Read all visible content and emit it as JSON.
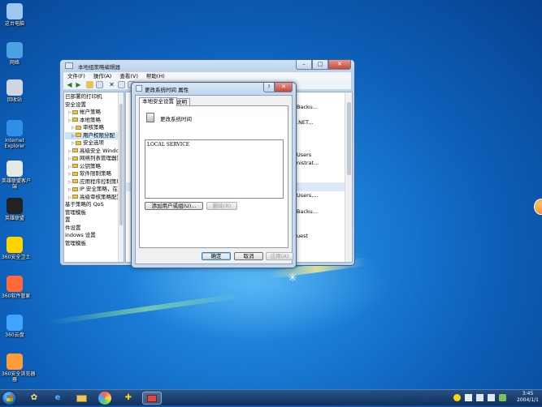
{
  "desktop": {
    "icons": [
      {
        "label": "这台电脑",
        "icon": "computer-icon"
      },
      {
        "label": "网络",
        "icon": "network-icon"
      },
      {
        "label": "回收站",
        "icon": "recycle-bin-icon"
      },
      {
        "label": "Internet",
        "label2": "Explorer",
        "icon": "ie-icon"
      },
      {
        "label": "英雄联盟客户",
        "label2": "端",
        "icon": "lol-client-icon"
      },
      {
        "label": "英雄联盟",
        "icon": "lol-icon"
      },
      {
        "label": "360安全卫士",
        "icon": "360-safe-icon"
      },
      {
        "label": "360软件管家",
        "icon": "360-soft-icon"
      },
      {
        "label": "360云盘",
        "icon": "360-cloud-icon"
      },
      {
        "label": "360安全浏览器",
        "label2": "器",
        "icon": "360-browser-icon"
      }
    ]
  },
  "main_window": {
    "title": "本地组策略编辑器",
    "menu": [
      "文件(F)",
      "操作(A)",
      "查看(V)",
      "帮助(H)"
    ],
    "tree": [
      {
        "text": "已部署的打印机",
        "indent": 0,
        "folder": false
      },
      {
        "text": "安全设置",
        "indent": 0,
        "folder": false
      },
      {
        "text": "帐户策略",
        "indent": 1,
        "folder": true
      },
      {
        "text": "本地策略",
        "indent": 1,
        "folder": true
      },
      {
        "text": "审核策略",
        "indent": 2,
        "folder": true
      },
      {
        "text": "用户权限分配",
        "indent": 2,
        "folder": true,
        "selected": true
      },
      {
        "text": "安全选项",
        "indent": 2,
        "folder": true
      },
      {
        "text": "高级安全 Windows 防",
        "indent": 1,
        "folder": true
      },
      {
        "text": "网络列表管理器策略",
        "indent": 1,
        "folder": true
      },
      {
        "text": "公钥策略",
        "indent": 1,
        "folder": true
      },
      {
        "text": "软件限制策略",
        "indent": 1,
        "folder": true
      },
      {
        "text": "应用程序控制策略",
        "indent": 1,
        "folder": true
      },
      {
        "text": "IP 安全策略，在 本地",
        "indent": 1,
        "folder": true
      },
      {
        "text": "高级审核策略配置",
        "indent": 1,
        "folder": true
      },
      {
        "text": "基于策略的 QoS",
        "indent": 0,
        "folder": false
      },
      {
        "text": "管理模板",
        "indent": 0,
        "folder": false
      },
      {
        "text": "置",
        "indent": 0,
        "folder": false
      },
      {
        "text": "件设置",
        "indent": 0,
        "folder": false
      },
      {
        "text": "indows 设置",
        "indent": 0,
        "folder": false
      },
      {
        "text": "管理模板",
        "indent": 0,
        "folder": false
      }
    ],
    "right_items": [
      "Backu...",
      ".NET...",
      "Users",
      "nistrat...",
      "Users,...",
      "Backu...",
      "uest"
    ]
  },
  "dialog": {
    "title": "更改系统时间 属性",
    "tabs": [
      "本地安全设置",
      "说明"
    ],
    "policy_name": "更改系统时间",
    "accounts": [
      "LOCAL SERVICE"
    ],
    "add_button": "添加用户或组(U)...",
    "remove_button": "删除(R)",
    "ok": "确定",
    "cancel": "取消",
    "apply": "应用(A)"
  },
  "taskbar": {
    "time": "3:45",
    "date": "2004/1/1"
  },
  "colors": {
    "desktop": "#1c7fd8",
    "title_bar": "#b9d1ec",
    "close_button": "#c9473a",
    "selection": "#cce4f7"
  }
}
